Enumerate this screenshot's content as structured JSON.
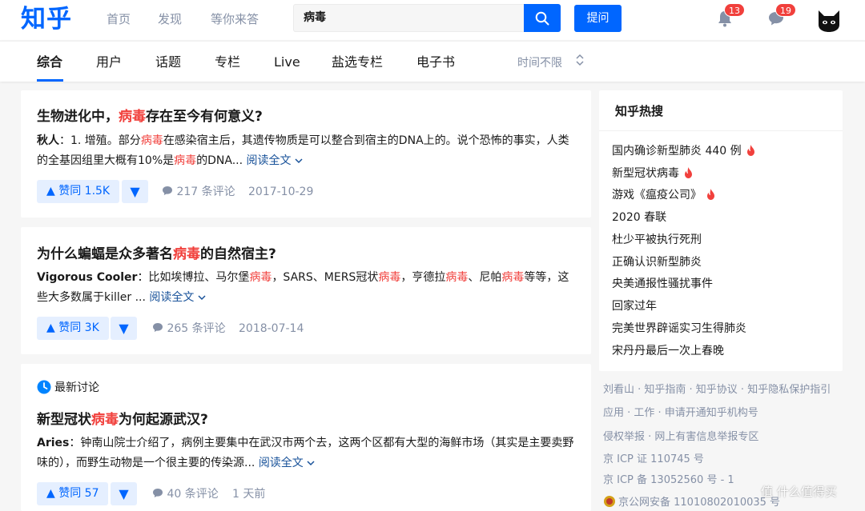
{
  "header": {
    "logo": "知乎",
    "nav": [
      "首页",
      "发现",
      "等你来答"
    ],
    "search_value": "病毒",
    "ask_label": "提问",
    "notifications_count": "13",
    "messages_count": "19"
  },
  "tabs": {
    "items": [
      "综合",
      "用户",
      "话题",
      "专栏",
      "Live",
      "盐选专栏",
      "电子书"
    ],
    "time_filter": "时间不限"
  },
  "results": [
    {
      "title_pre": "生物进化中，",
      "title_hl": "病毒",
      "title_post": "存在至今有何意义?",
      "author": "秋人",
      "ex1": "：1. 增殖。部分",
      "ex_hl1": "病毒",
      "ex2": "在感染宿主后，其遗传物质是可以整合到宿主的DNA上的。说个恐怖的事实，人类的全基因组里大概有10%是",
      "ex_hl2": "病毒",
      "ex3": "的DNA...",
      "read_more": "阅读全文",
      "votes": "赞同 1.5K",
      "comments": "217 条评论",
      "date": "2017-10-29"
    },
    {
      "title_pre": "为什么蝙蝠是众多著名",
      "title_hl": "病毒",
      "title_post": "的自然宿主?",
      "author": "Vigorous Cooler",
      "ex1": "：比如埃博拉、马尔堡",
      "ex_hl1": "病毒",
      "ex2": "，SARS、MERS冠状",
      "ex_hl2": "病毒",
      "ex3": "，亨德拉",
      "ex_hl3": "病毒",
      "ex4": "、尼帕",
      "ex_hl4": "病毒",
      "ex5": "等等，这些大多数属于killer ...",
      "read_more": "阅读全文",
      "votes": "赞同 3K",
      "comments": "265 条评论",
      "date": "2018-07-14"
    },
    {
      "section": "最新讨论",
      "title_pre": "新型冠状",
      "title_hl": "病毒",
      "title_post": "为何起源武汉?",
      "author": "Aries",
      "ex1": "：钟南山院士介绍了，病例主要集中在武汉市两个去，这两个区都有大型的海鲜市场（其实是主要卖野味的），而野生动物是一个很主要的传染源...",
      "read_more": "阅读全文",
      "votes": "赞同 57",
      "comments": "40 条评论",
      "date": "1 天前"
    }
  ],
  "sidebar": {
    "title": "知乎热搜",
    "items": [
      "国内确诊新型肺炎 440 例",
      "新型冠状病毒",
      "游戏《瘟疫公司》",
      "2020 春联",
      "杜少平被执行死刑",
      "正确认识新型肺炎",
      "央美通报性骚扰事件",
      "回家过年",
      "完美世界辟谣实习生得肺炎",
      "宋丹丹最后一次上春晚"
    ]
  },
  "footer": {
    "line1": "刘看山 · 知乎指南 · 知乎协议 · 知乎隐私保护指引",
    "line2": "应用 · 工作 · 申请开通知乎机构号",
    "line3": "侵权举报 · 网上有害信息举报专区",
    "line4": "京 ICP 证 110745 号",
    "line5": "京 ICP 备 13052560 号 - 1",
    "line6": "京公网安备 11010802010035 号"
  },
  "watermark": "值 什么值得买",
  "colors": {
    "brand": "#0066ff",
    "highlight": "#f1403c",
    "muted": "#8590a6",
    "link": "#175199"
  }
}
